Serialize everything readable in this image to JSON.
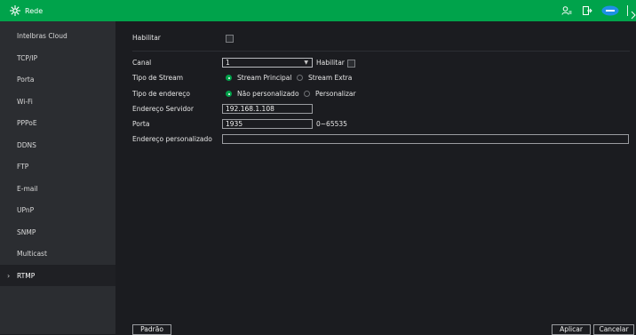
{
  "header": {
    "title": "Rede",
    "icons": [
      "network-logo-icon",
      "user-icon",
      "logout-icon",
      "intelbras-badge-icon"
    ],
    "accent": "#00a34b"
  },
  "sidebar": {
    "items": [
      {
        "label": "Intelbras Cloud"
      },
      {
        "label": "TCP/IP"
      },
      {
        "label": "Porta"
      },
      {
        "label": "Wi-Fi"
      },
      {
        "label": "PPPoE"
      },
      {
        "label": "DDNS"
      },
      {
        "label": "FTP"
      },
      {
        "label": "E-mail"
      },
      {
        "label": "UPnP"
      },
      {
        "label": "SNMP"
      },
      {
        "label": "Multicast"
      },
      {
        "label": "RTMP",
        "active": true
      }
    ],
    "active_chevron": "›"
  },
  "form": {
    "habilitar_label": "Habilitar",
    "habilitar_checked": false,
    "canal_label": "Canal",
    "canal_value": "1",
    "canal_habilitar_label": "Habilitar",
    "tipo_stream_label": "Tipo de Stream",
    "stream_principal": "Stream Principal",
    "stream_extra": "Stream Extra",
    "tipo_endereco_label": "Tipo de endereço",
    "nao_personalizado": "Não personalizado",
    "personalizar": "Personalizar",
    "endereco_servidor_label": "Endereço Servidor",
    "endereco_servidor_value": "192.168.1.108",
    "porta_label": "Porta",
    "porta_value": "1935",
    "porta_range": "0~65535",
    "endereco_personalizado_label": "Endereço personalizado",
    "endereco_personalizado_value": ""
  },
  "footer": {
    "padrao": "Padrão",
    "aplicar": "Aplicar",
    "cancelar": "Cancelar"
  }
}
